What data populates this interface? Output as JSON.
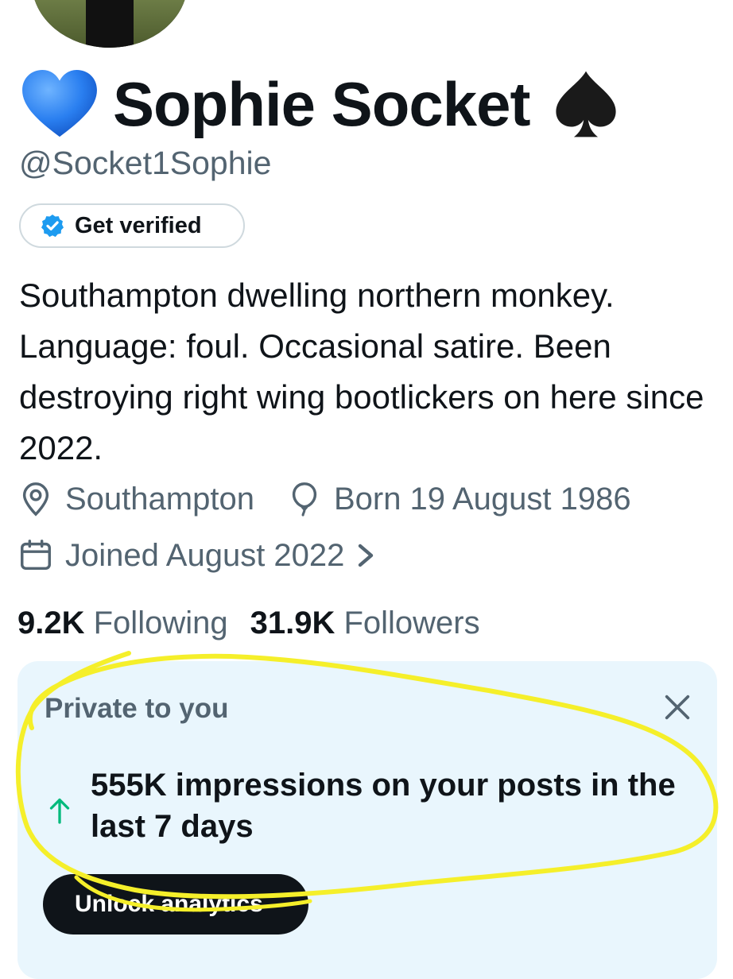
{
  "profile": {
    "display_name": "Sophie Socket",
    "handle": "@Socket1Sophie",
    "leading_emoji": "blue-heart",
    "trailing_emoji": "spade-suit",
    "verify_button_label": "Get verified",
    "bio": "Southampton dwelling northern monkey. Language: foul. Occasional satire. Been destroying right wing bootlickers on here since 2022.",
    "location": "Southampton",
    "birthday": "Born 19 August 1986",
    "joined": "Joined August 2022"
  },
  "stats": {
    "following_count": "9.2K",
    "following_label": "Following",
    "followers_count": "31.9K",
    "followers_label": "Followers"
  },
  "private_card": {
    "label": "Private to you",
    "message": "555K impressions on your posts in the last 7 days",
    "button_label": "Unlock analytics"
  },
  "colors": {
    "text_primary": "#0f1419",
    "text_secondary": "#536471",
    "card_background": "#e9f6fd",
    "verify_badge": "#1d9bf0",
    "trend_up": "#00ba7c",
    "highlight_scribble": "#f5ef2a",
    "heart": "#2a7ff0"
  },
  "icons": [
    "blue-heart-icon",
    "spade-icon",
    "verified-badge-icon",
    "location-pin-icon",
    "balloon-icon",
    "calendar-icon",
    "chevron-right-icon",
    "close-icon",
    "arrow-up-icon"
  ]
}
